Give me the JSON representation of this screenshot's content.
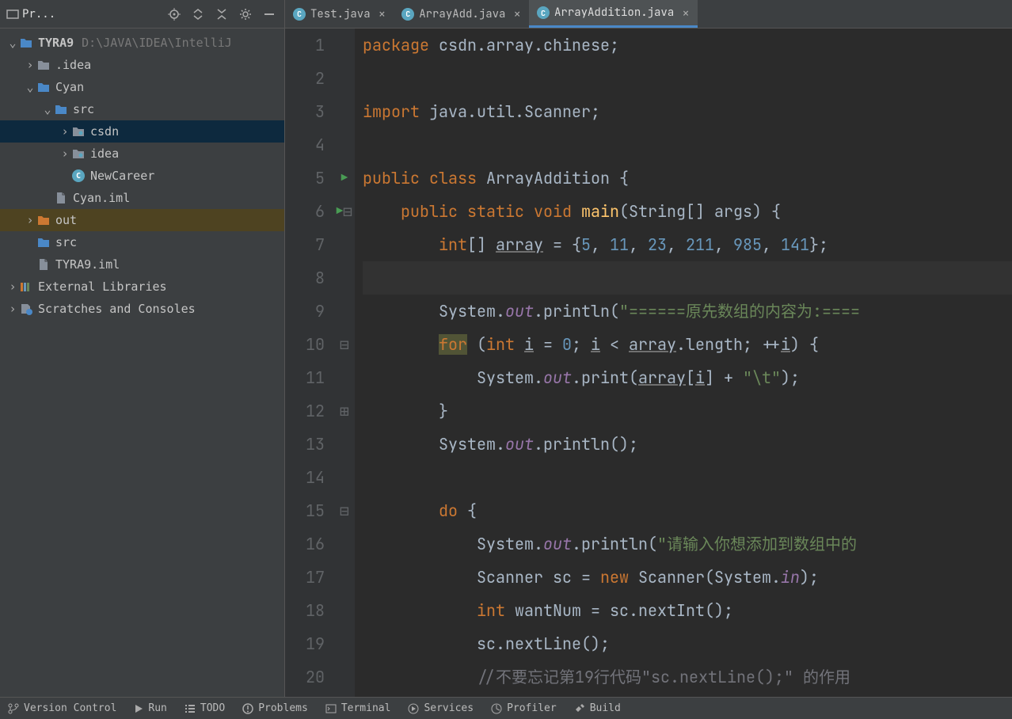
{
  "sidebar": {
    "project_label": "Pr...",
    "tree": [
      {
        "depth": 0,
        "chev": "v",
        "icon": "folder-blue",
        "label": "TYRA9",
        "hint": "D:\\JAVA\\IDEA\\IntelliJ",
        "bold": true
      },
      {
        "depth": 1,
        "chev": ">",
        "icon": "folder",
        "label": ".idea"
      },
      {
        "depth": 1,
        "chev": "v",
        "icon": "folder-blue",
        "label": "Cyan"
      },
      {
        "depth": 2,
        "chev": "v",
        "icon": "folder-blue",
        "label": "src"
      },
      {
        "depth": 3,
        "chev": ">",
        "icon": "folder-pkg",
        "label": "csdn",
        "selected": true
      },
      {
        "depth": 3,
        "chev": ">",
        "icon": "folder-pkg",
        "label": "idea"
      },
      {
        "depth": 3,
        "chev": "",
        "icon": "java",
        "label": "NewCareer"
      },
      {
        "depth": 2,
        "chev": "",
        "icon": "file",
        "label": "Cyan.iml"
      },
      {
        "depth": 1,
        "chev": ">",
        "icon": "folder-orange",
        "label": "out",
        "highlight": true
      },
      {
        "depth": 1,
        "chev": "",
        "icon": "folder-blue",
        "label": "src"
      },
      {
        "depth": 1,
        "chev": "",
        "icon": "file",
        "label": "TYRA9.iml"
      },
      {
        "depth": 0,
        "chev": ">",
        "icon": "lib",
        "label": "External Libraries"
      },
      {
        "depth": 0,
        "chev": ">",
        "icon": "scratch",
        "label": "Scratches and Consoles"
      }
    ]
  },
  "tabs": [
    {
      "label": "Test.java",
      "active": false
    },
    {
      "label": "ArrayAdd.java",
      "active": false
    },
    {
      "label": "ArrayAddition.java",
      "active": true
    }
  ],
  "editor": {
    "line_numbers": [
      "1",
      "2",
      "3",
      "4",
      "5",
      "6",
      "7",
      "8",
      "9",
      "10",
      "11",
      "12",
      "13",
      "14",
      "15",
      "16",
      "17",
      "18",
      "19",
      "20"
    ],
    "run_markers": {
      "5": true,
      "6": true
    },
    "fold_markers": {
      "6": "open",
      "10": "open",
      "12": "close",
      "15": "open"
    },
    "caret_line": 8
  },
  "statusbar": {
    "version_control": "Version Control",
    "run": "Run",
    "todo": "TODO",
    "problems": "Problems",
    "terminal": "Terminal",
    "services": "Services",
    "profiler": "Profiler",
    "build": "Build"
  },
  "code_tokens": {
    "l1": {
      "a": "package ",
      "b": "csdn.array.chinese;"
    },
    "l3": {
      "a": "import ",
      "b": "java.util.Scanner;"
    },
    "l5": {
      "a": "public class ",
      "b": "ArrayAddition ",
      "c": "{"
    },
    "l6": {
      "a": "public static void ",
      "b": "main",
      "c": "(String[] args) {"
    },
    "l7": {
      "a": "int",
      "b": "[] ",
      "c": "array",
      "d": " = {",
      "v1": "5",
      "v2": "11",
      "v3": "23",
      "v4": "211",
      "v5": "985",
      "v6": "141",
      "e": "};"
    },
    "l9": {
      "a": "System.",
      "b": "out",
      "c": ".println(",
      "d": "\"======",
      "e": "原先数组的内容为:",
      "f": "===="
    },
    "l10": {
      "a": "for",
      "b": " (",
      "c": "int ",
      "d": "i",
      "e": " = ",
      "f": "0",
      "g": "; ",
      "h": "i",
      "i": " < ",
      "j": "array",
      "k": ".length; ++",
      "l": "i",
      "m": ") {"
    },
    "l11": {
      "a": "System.",
      "b": "out",
      "c": ".print(",
      "d": "array",
      "e": "[",
      "f": "i",
      "g": "] + ",
      "h": "\"\\t\"",
      "i": ");"
    },
    "l12": {
      "a": "}"
    },
    "l13": {
      "a": "System.",
      "b": "out",
      "c": ".println();"
    },
    "l15": {
      "a": "do ",
      "b": "{"
    },
    "l16": {
      "a": "System.",
      "b": "out",
      "c": ".println(",
      "d": "\"",
      "e": "请输入你想添加到数组中的"
    },
    "l17": {
      "a": "Scanner sc = ",
      "b": "new ",
      "c": "Scanner(System.",
      "d": "in",
      "e": ");"
    },
    "l18": {
      "a": "int ",
      "b": "wantNum = sc.nextInt();"
    },
    "l19": {
      "a": "sc.nextLine();"
    },
    "l20": {
      "a": "//不要忘记第19行代码\"sc.nextLine();\" 的作用"
    }
  }
}
